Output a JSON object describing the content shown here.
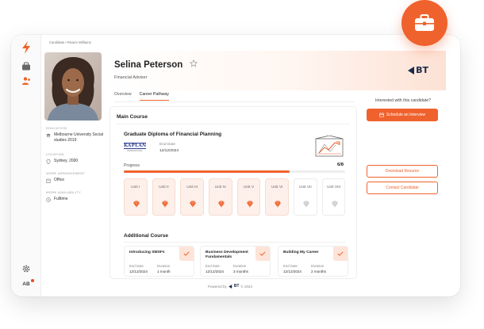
{
  "breadcrumb": {
    "root": "Candidate",
    "separator": "•",
    "current": "Rowen Williams"
  },
  "profile": {
    "name": "Selina Peterson",
    "role": "Financial Adviser",
    "brand": "BT",
    "starred": false
  },
  "sidebar": {
    "education_label": "EDUCATION",
    "education_value": "Melbourne University Social studies 2019",
    "location_label": "LOCATION",
    "location_value": "Sydney, 2000",
    "work_arrangement_label": "WORK ARRANGEMENT",
    "work_arrangement_value": "Office",
    "work_availability_label": "WORK AVAILABILITY",
    "work_availability_value": "Fulltime",
    "user_initials": "AB"
  },
  "tabs": [
    {
      "label": "Overview",
      "active": false
    },
    {
      "label": "Career Pathway",
      "active": true
    }
  ],
  "main_course": {
    "section_title": "Main Course",
    "title": "Graduate Diploma of Financial Planning",
    "provider": "KAPLAN",
    "provider_sub": "PROFESSIONAL",
    "end_date_label": "End Date",
    "end_date": "12/12/2024",
    "progress_label": "Progress",
    "progress_text": "6/8",
    "progress_fraction": 0.75,
    "units": [
      {
        "label": "Unit I",
        "done": true
      },
      {
        "label": "Unit II",
        "done": true
      },
      {
        "label": "Unit III",
        "done": true
      },
      {
        "label": "Unit IV",
        "done": true
      },
      {
        "label": "Unit V",
        "done": true
      },
      {
        "label": "Unit VI",
        "done": true
      },
      {
        "label": "Unit VII",
        "done": false
      },
      {
        "label": "Unit VIII",
        "done": false
      }
    ]
  },
  "additional": {
    "section_title": "Additional Course",
    "end_date_label": "End Date",
    "duration_label": "Duration",
    "courses": [
      {
        "title": "Introducing SMSFs",
        "end_date": "12/12/2024",
        "duration": "1 month"
      },
      {
        "title": "Business Development Fundamentals",
        "end_date": "12/12/2024",
        "duration": "3 months"
      },
      {
        "title": "Building My Career",
        "end_date": "12/12/2024",
        "duration": "2 months"
      }
    ]
  },
  "cta": {
    "question": "Interested with this candidate?",
    "schedule": "Schedule an Interview",
    "download": "Download Resume",
    "contact": "Contact Candidate"
  },
  "footer": {
    "powered_by": "Powered by",
    "brand": "BT",
    "year": "© 2024"
  },
  "colors": {
    "accent": "#f0622d",
    "accent_soft": "#fde4d8",
    "brand_navy": "#1b2a4a"
  }
}
